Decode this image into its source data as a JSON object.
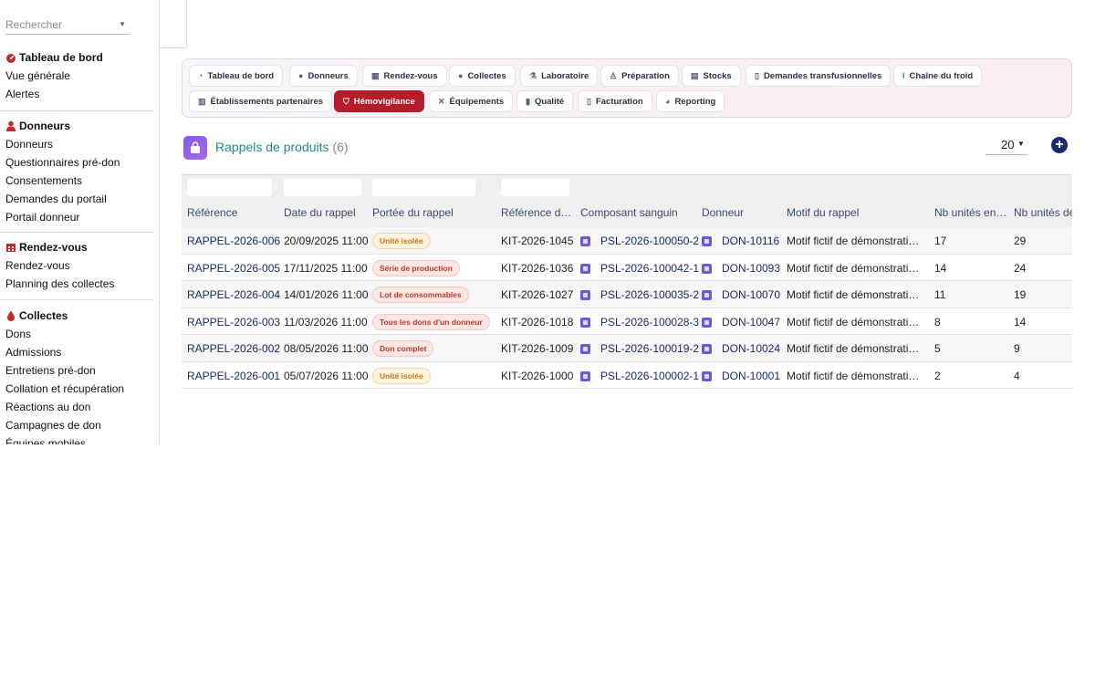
{
  "search": {
    "placeholder": "Rechercher"
  },
  "sidebar": {
    "sections": [
      {
        "title": "Tableau de bord",
        "icon": "gauge-icon",
        "items": [
          "Vue générale",
          "Alertes"
        ]
      },
      {
        "title": "Donneurs",
        "icon": "person-icon",
        "items": [
          "Donneurs",
          "Questionnaires pré-don",
          "Consentements",
          "Demandes du portail",
          "Portail donneur"
        ]
      },
      {
        "title": "Rendez-vous",
        "icon": "calendar-icon",
        "items": [
          "Rendez-vous",
          "Planning des collectes"
        ]
      },
      {
        "title": "Collectes",
        "icon": "drop-icon",
        "items": [
          "Dons",
          "Admissions",
          "Entretiens pré-don",
          "Collation et récupération",
          "Réactions au don",
          "Campagnes de don",
          "Équipes mobiles"
        ]
      }
    ]
  },
  "menu": {
    "row1": [
      "Tableau de bord",
      "Donneurs",
      "Rendez-vous",
      "Collectes",
      "Laboratoire",
      "Préparation",
      "Stocks",
      "Demandes transfusionnelles",
      "Chaîne du froid"
    ],
    "row2": [
      "Établissements partenaires",
      "Hémovigilance",
      "Équipements",
      "Qualité",
      "Facturation",
      "Reporting"
    ],
    "active": "Hémovigilance"
  },
  "list": {
    "title": "Rappels de produits",
    "count": "(6)",
    "page_size": "20",
    "add_label": "+"
  },
  "table": {
    "headers": [
      "Référence",
      "Date du rappel",
      "Portée du rappel",
      "Référence d…",
      "Composant sanguin",
      "Donneur",
      "Motif du rappel",
      "Nb unités en…",
      "Nb unités dé"
    ],
    "rows": [
      {
        "ref": "RAPPEL-2026-006",
        "date": "20/09/2025 11:00",
        "scope": "Unité isolée",
        "kit": "KIT-2026-1045",
        "component": "PSL-2026-100050-2",
        "donor": "DON-10116",
        "reason": "Motif fictif de démonstration …",
        "n1": "17",
        "n2": "29"
      },
      {
        "ref": "RAPPEL-2026-005",
        "date": "17/11/2025 11:00",
        "scope": "Série de production",
        "kit": "KIT-2026-1036",
        "component": "PSL-2026-100042-1",
        "donor": "DON-10093",
        "reason": "Motif fictif de démonstration …",
        "n1": "14",
        "n2": "24"
      },
      {
        "ref": "RAPPEL-2026-004",
        "date": "14/01/2026 11:00",
        "scope": "Lot de consommables",
        "kit": "KIT-2026-1027",
        "component": "PSL-2026-100035-2",
        "donor": "DON-10070",
        "reason": "Motif fictif de démonstration …",
        "n1": "11",
        "n2": "19"
      },
      {
        "ref": "RAPPEL-2026-003",
        "date": "11/03/2026 11:00",
        "scope": "Tous les dons d'un donneur",
        "kit": "KIT-2026-1018",
        "component": "PSL-2026-100028-3",
        "donor": "DON-10047",
        "reason": "Motif fictif de démonstration …",
        "n1": "8",
        "n2": "14"
      },
      {
        "ref": "RAPPEL-2026-002",
        "date": "08/05/2026 11:00",
        "scope": "Don complet",
        "kit": "KIT-2026-1009",
        "component": "PSL-2026-100019-2",
        "donor": "DON-10024",
        "reason": "Motif fictif de démonstration …",
        "n1": "5",
        "n2": "9"
      },
      {
        "ref": "RAPPEL-2026-001",
        "date": "05/07/2026 11:00",
        "scope": "Unité isolée",
        "kit": "KIT-2026-1000",
        "component": "PSL-2026-100002-1",
        "donor": "DON-10001",
        "reason": "Motif fictif de démonstration …",
        "n1": "2",
        "n2": "4"
      }
    ]
  },
  "colors": {
    "accent_red": "#b51c2a",
    "link_navy": "#1a2a6c",
    "title_teal": "#1e8a9a",
    "chip_red": "#c0392b",
    "chip_amber": "#c77912"
  }
}
